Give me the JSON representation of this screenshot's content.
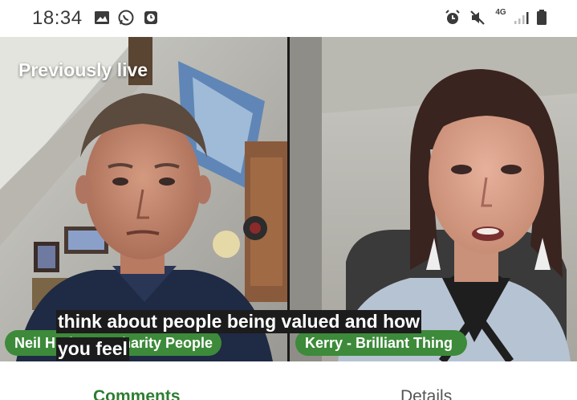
{
  "status_bar": {
    "time": "18:34",
    "network": "4G",
    "left_icons": [
      "image-icon",
      "whatsapp-icon",
      "clock-app-icon"
    ],
    "right_icons": [
      "alarm-icon",
      "mute-icon",
      "signal-icon",
      "battery-icon"
    ]
  },
  "video": {
    "live_label": "Previously live",
    "caption_lines": [
      "think about people being valued and how",
      "you feel"
    ],
    "participants": [
      {
        "name": "Neil Hudson - Charity People",
        "visible_name": "Neil H… …arity People"
      },
      {
        "name": "Kerry - Brilliant Thing"
      }
    ]
  },
  "tabs": [
    {
      "label": "Comments",
      "active": true
    },
    {
      "label": "Details",
      "active": false
    }
  ],
  "colors": {
    "accent_green": "#3d8a3a",
    "active_tab": "#2e7d32"
  }
}
